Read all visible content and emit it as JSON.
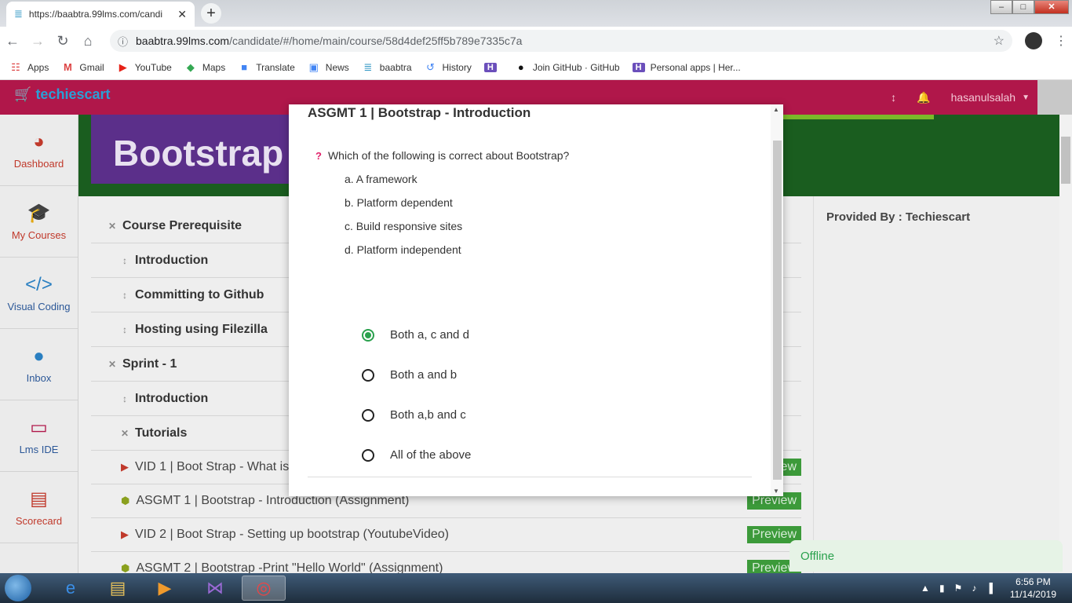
{
  "browser": {
    "tab_title": "https://baabtra.99lms.com/candi",
    "url_host": "baabtra.99lms.com",
    "url_path": "/candidate/#/home/main/course/58d4def25ff5b789e7335c7a",
    "bookmarks": [
      {
        "label": "Apps",
        "icon": "apps-grid-icon"
      },
      {
        "label": "Gmail",
        "icon": "gmail-icon"
      },
      {
        "label": "YouTube",
        "icon": "youtube-icon"
      },
      {
        "label": "Maps",
        "icon": "maps-icon"
      },
      {
        "label": "Translate",
        "icon": "translate-icon"
      },
      {
        "label": "News",
        "icon": "news-icon"
      },
      {
        "label": "baabtra",
        "icon": "baabtra-icon"
      },
      {
        "label": "History",
        "icon": "history-icon"
      },
      {
        "label": "",
        "icon": "bookmark-h-icon"
      },
      {
        "label": "Join GitHub · GitHub",
        "icon": "github-icon"
      },
      {
        "label": "Personal apps | Her...",
        "icon": "heroku-icon"
      }
    ]
  },
  "app": {
    "logo": "techiescart",
    "username": "hasanulsalah"
  },
  "sidebar": {
    "items": [
      {
        "label": "Dashboard",
        "icon": "dashboard-icon"
      },
      {
        "label": "My Courses",
        "icon": "graduation-cap-icon"
      },
      {
        "label": "Visual Coding",
        "icon": "code-icon"
      },
      {
        "label": "Inbox",
        "icon": "chat-icon"
      },
      {
        "label": "Lms IDE",
        "icon": "ide-icon"
      },
      {
        "label": "Scorecard",
        "icon": "book-icon"
      }
    ]
  },
  "banner": {
    "text": "Bootstrap"
  },
  "course": {
    "rows": [
      {
        "label": "Course Prerequisite"
      },
      {
        "label": "Introduction"
      },
      {
        "label": "Committing to Github"
      },
      {
        "label": "Hosting using Filezilla"
      },
      {
        "label": "Sprint - 1"
      },
      {
        "label": "Introduction"
      },
      {
        "label": "Tutorials"
      },
      {
        "label": "VID 1 | Boot Strap - What is"
      },
      {
        "label": "ASGMT 1 | Bootstrap - Introduction  (Assignment)"
      },
      {
        "label": "VID 2 | Boot Strap - Setting up bootstrap  (YoutubeVideo)"
      },
      {
        "label": "ASGMT 2 | Bootstrap -Print \"Hello World\"  (Assignment)"
      }
    ],
    "preview_label": "Preview",
    "provided_by": "Provided By : Techiescart"
  },
  "modal": {
    "title": "ASGMT 1 | Bootstrap - Introduction",
    "question": "Which of the following is correct about Bootstrap?",
    "statements": [
      "a. A framework",
      "b. Platform dependent",
      "c. Build responsive sites",
      "d. Platform independent"
    ],
    "answers": [
      "Both a, c and d",
      "Both a and b",
      "Both a,b and c",
      "All of the above"
    ],
    "selected_answer": "Both a, c and d"
  },
  "chat": {
    "status": "Offline"
  },
  "taskbar": {
    "time": "6:56 PM",
    "date": "11/14/2019"
  }
}
